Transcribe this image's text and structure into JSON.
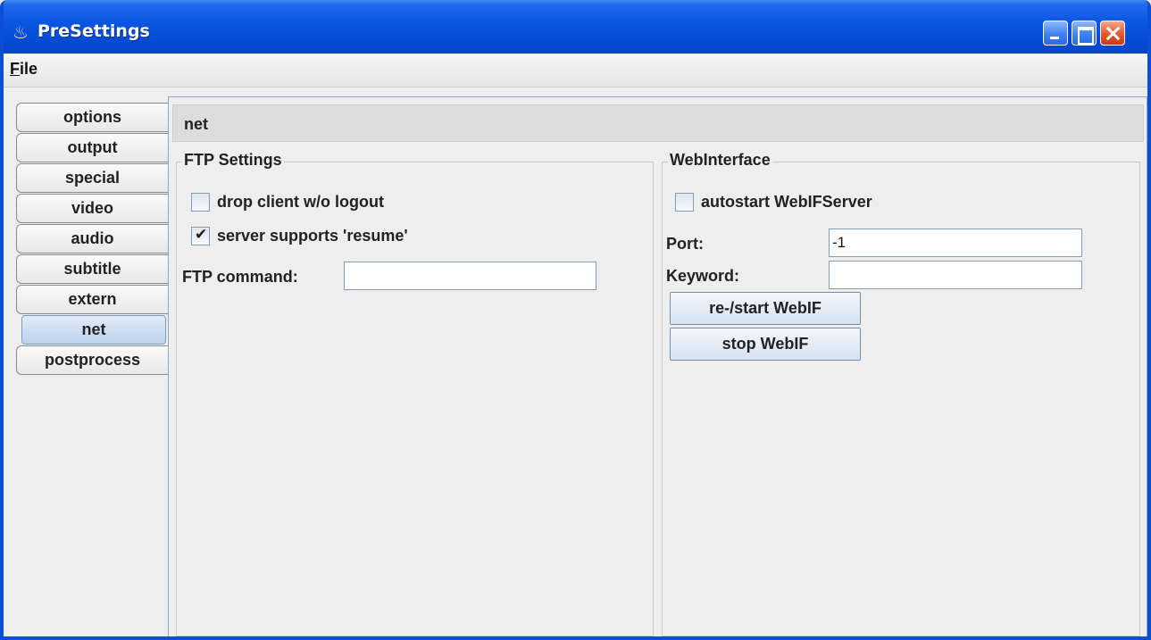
{
  "window": {
    "title": "PreSettings",
    "icon": "java-cup-icon"
  },
  "menu": {
    "file_mnemonic": "F",
    "file_rest": "ile"
  },
  "tabs": [
    {
      "label": "options",
      "selected": false
    },
    {
      "label": "output",
      "selected": false
    },
    {
      "label": "special",
      "selected": false
    },
    {
      "label": "video",
      "selected": false
    },
    {
      "label": "audio",
      "selected": false
    },
    {
      "label": "subtitle",
      "selected": false
    },
    {
      "label": "extern",
      "selected": false
    },
    {
      "label": "net",
      "selected": true
    },
    {
      "label": "postprocess",
      "selected": false
    }
  ],
  "panel": {
    "title": "net",
    "ftp": {
      "title": "FTP Settings",
      "drop_client": {
        "label": "drop client w/o logout",
        "checked": false
      },
      "resume": {
        "label": "server supports 'resume'",
        "checked": true
      },
      "command_label": "FTP command:",
      "command_value": ""
    },
    "web": {
      "title": "WebInterface",
      "autostart": {
        "label": "autostart WebIFServer",
        "checked": false
      },
      "port_label": "Port:",
      "port_value": "-1",
      "keyword_label": "Keyword:",
      "keyword_value": "",
      "restart_button": "re-/start WebIF",
      "stop_button": "stop WebIF"
    }
  }
}
